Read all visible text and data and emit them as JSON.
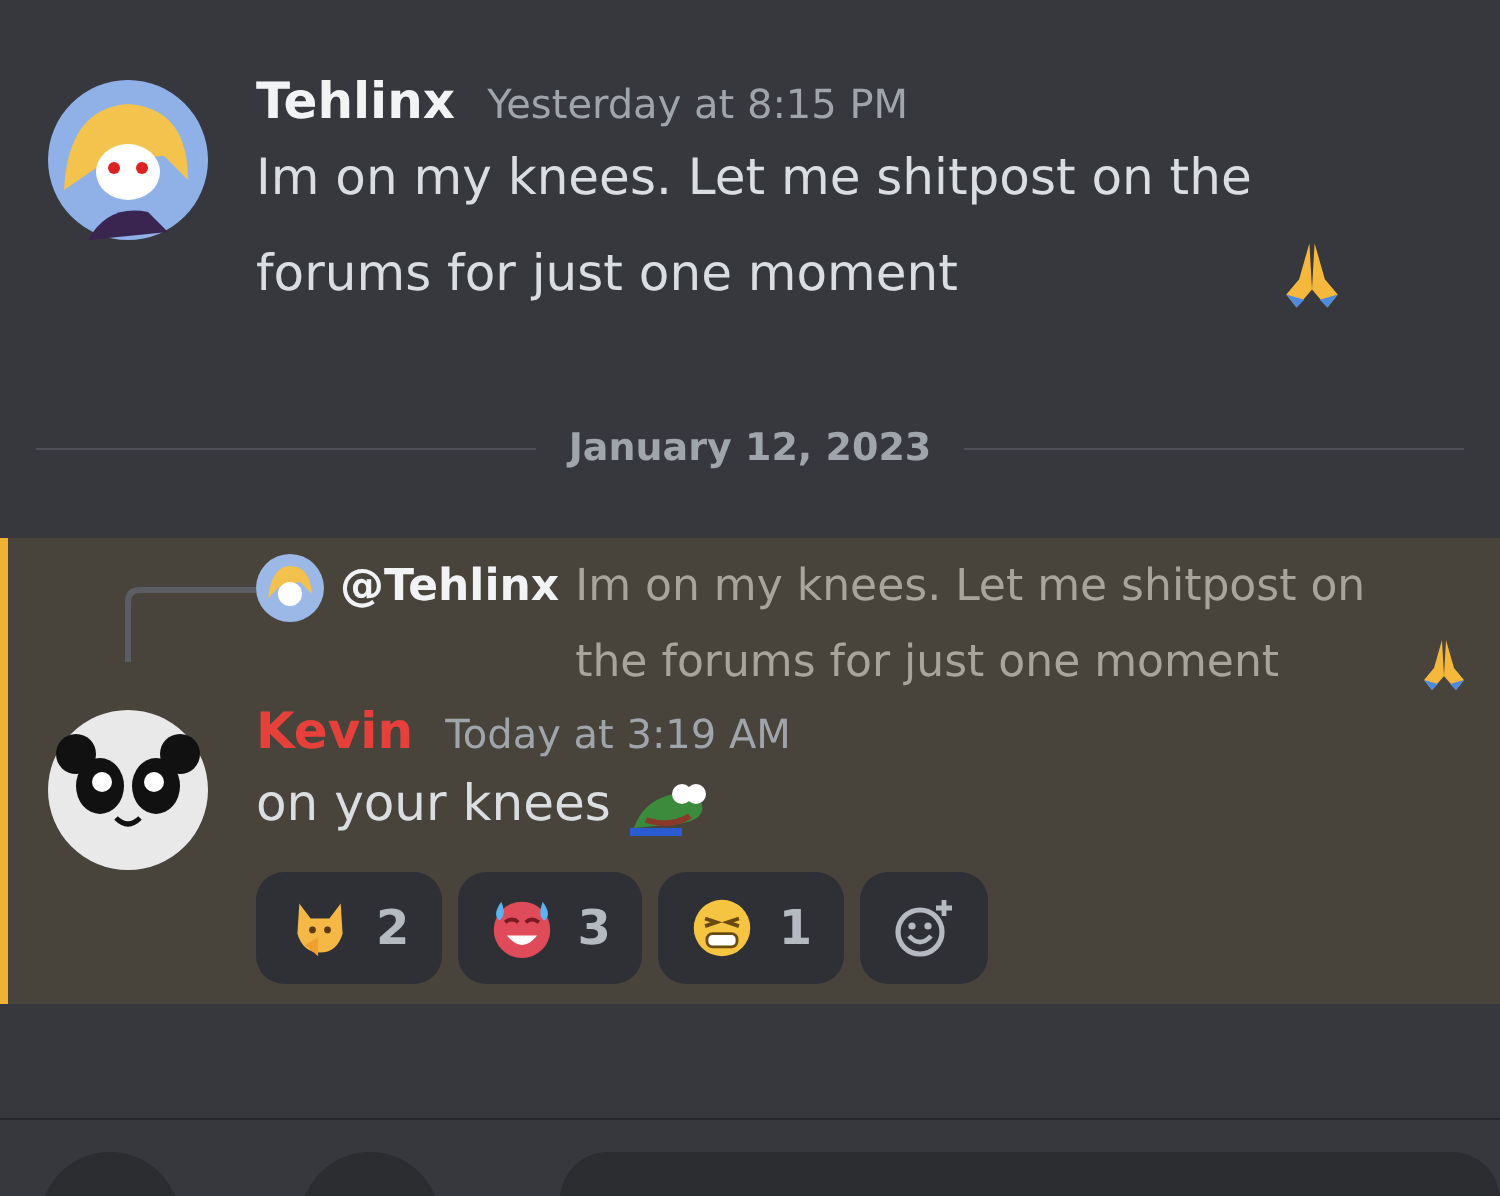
{
  "messages": [
    {
      "author": "Tehlinx",
      "color": "#f2f3f5",
      "timestamp": "Yesterday at 8:15 PM",
      "text": "Im on my knees. Let me shitpost on the forums for just one moment",
      "emoji": {
        "kind": "pray"
      }
    },
    {
      "date_divider": "January 12, 2023"
    },
    {
      "author": "Kevin",
      "color": "#e5413a",
      "timestamp": "Today at 3:19 AM",
      "text": "on your knees",
      "emoji": {
        "kind": "frog"
      },
      "highlighted": true,
      "reply": {
        "author": "@Tehlinx",
        "text": "Im on my knees. Let me shitpost on the forums for just one moment",
        "emoji": {
          "kind": "pray"
        }
      },
      "reactions": [
        {
          "kind": "fox",
          "count": "2"
        },
        {
          "kind": "hot",
          "count": "3"
        },
        {
          "kind": "tired",
          "count": "1"
        }
      ]
    }
  ]
}
